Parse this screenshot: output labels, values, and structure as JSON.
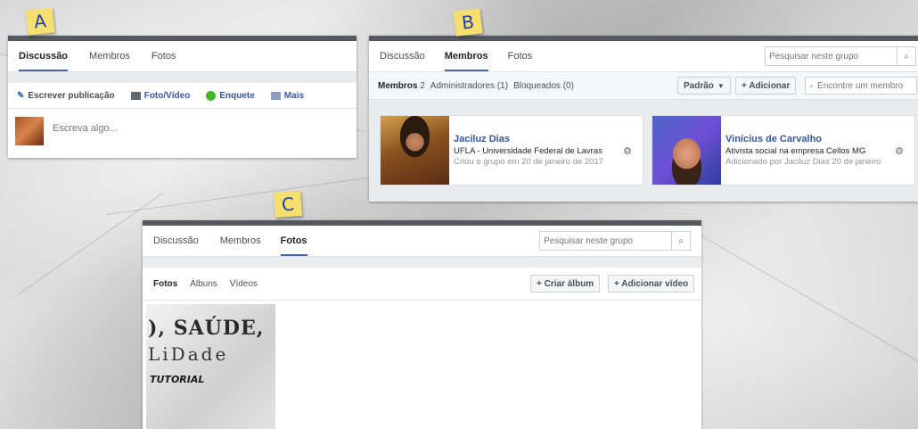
{
  "notes": {
    "a": "A",
    "b": "B",
    "c": "C"
  },
  "panel_a": {
    "tabs": [
      "Discussão",
      "Membros",
      "Fotos"
    ],
    "composer": {
      "write_post": "Escrever publicação",
      "photo_video": "Foto/Vídeo",
      "poll": "Enquete",
      "more": "Mais",
      "placeholder": "Escreva algo..."
    }
  },
  "panel_b": {
    "tabs": [
      "Discussão",
      "Membros",
      "Fotos"
    ],
    "search_placeholder": "Pesquisar neste grupo",
    "filters": {
      "members_label": "Membros",
      "members_count": "2",
      "admins_label": "Administradores",
      "admins_count": "(1)",
      "blocked_label": "Bloqueados",
      "blocked_count": "(0)"
    },
    "sort_label": "Padrão",
    "add_label": "+ Adicionar",
    "find_member_placeholder": "Encontre um membro",
    "members": [
      {
        "name": "Jaciluz Dias",
        "line1": "UFLA - Universidade Federal de Lavras",
        "line2": "Criou o grupo em 20 de janeiro de 2017"
      },
      {
        "name": "Vinícius de Carvalho",
        "line1": "Ativista social na empresa Cellos MG",
        "line2": "Adicionado por Jaciluz Dias 20 de janeiro"
      }
    ]
  },
  "panel_c": {
    "tabs": [
      "Discussão",
      "Membros",
      "Fotos"
    ],
    "search_placeholder": "Pesquisar neste grupo",
    "subtabs": [
      "Fotos",
      "Álbuns",
      "Vídeos"
    ],
    "create_album": "+ Criar álbum",
    "add_video": "+ Adicionar vídeo",
    "thumb_text": {
      "line1": "), SAÚDE,",
      "line2": "LiDade",
      "line3": "TUTORIAL"
    }
  },
  "colors": {
    "accent": "#4267b2",
    "link": "#365899",
    "note": "#f5df6e",
    "note_ink": "#1d3ea6"
  },
  "icons": [
    "pencil-icon",
    "photo-icon",
    "poll-icon",
    "more-icon",
    "search-icon",
    "gear-icon",
    "chevron-down-icon"
  ]
}
